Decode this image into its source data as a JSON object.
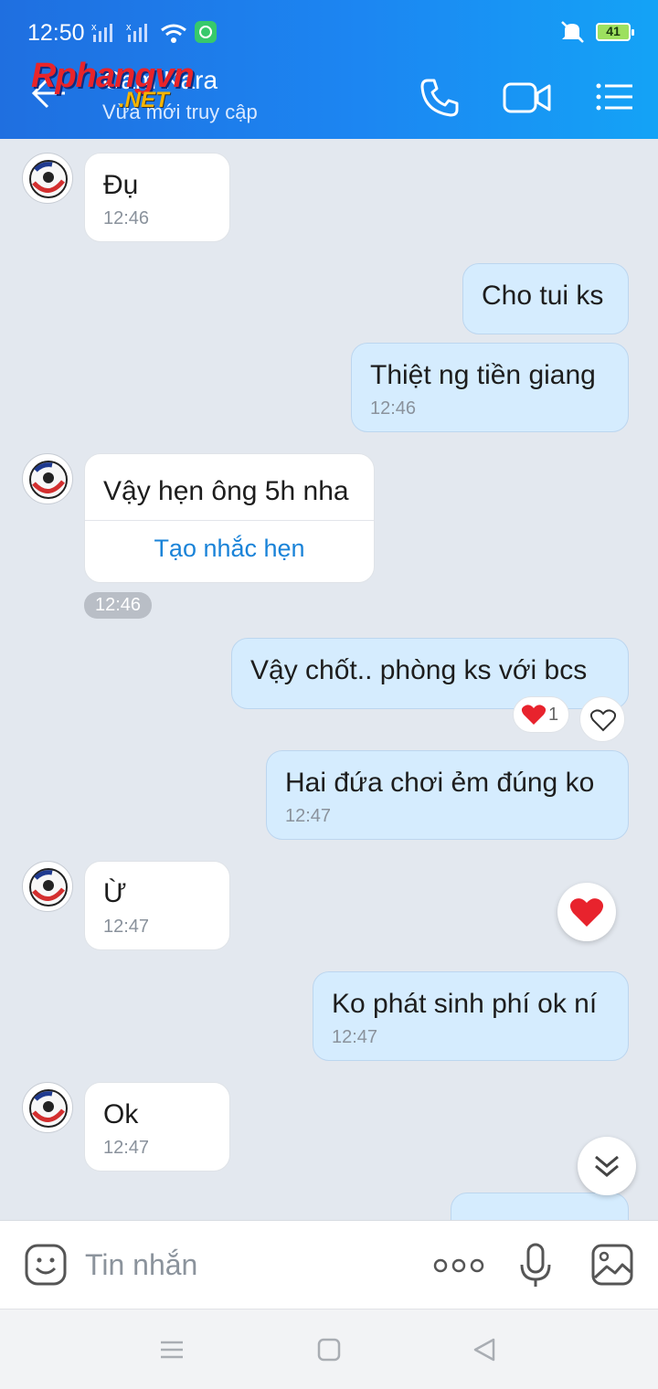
{
  "status_bar": {
    "time": "12:50",
    "battery": "41"
  },
  "header": {
    "contact_name": "Cam Kara",
    "status": "Vừa mới truy cập",
    "watermark": "Rphangvn",
    "watermark_suffix": ".NET"
  },
  "messages": [
    {
      "id": 1,
      "direction": "in",
      "text": "Đụ",
      "time": "12:46"
    },
    {
      "id": 2,
      "direction": "out",
      "text": "Cho tui ks",
      "time": ""
    },
    {
      "id": 3,
      "direction": "out",
      "text": "Thiệt ng tiền giang",
      "time": "12:46"
    },
    {
      "id": 4,
      "direction": "in",
      "text": "Vậy hẹn ông 5h nha",
      "action": "Tạo nhắc hẹn",
      "time": "12:46"
    },
    {
      "id": 5,
      "direction": "out",
      "text": "Vậy chốt.. phòng ks với bcs",
      "reaction_count": "1"
    },
    {
      "id": 6,
      "direction": "out",
      "text": "Hai đứa chơi ẻm đúng ko",
      "time": "12:47"
    },
    {
      "id": 7,
      "direction": "in",
      "text": "Ừ",
      "time": "12:47"
    },
    {
      "id": 8,
      "direction": "out",
      "text": "Ko phát sinh phí ok ní",
      "time": "12:47"
    },
    {
      "id": 9,
      "direction": "in",
      "text": "Ok",
      "time": "12:47"
    }
  ],
  "input": {
    "placeholder": "Tin nhắn"
  },
  "colors": {
    "accent": "#1c86f2",
    "outgoing_bubble": "#d5ecfe",
    "incoming_bubble": "#ffffff",
    "chat_bg": "#e3e8ef",
    "reaction_heart": "#e8232d"
  }
}
